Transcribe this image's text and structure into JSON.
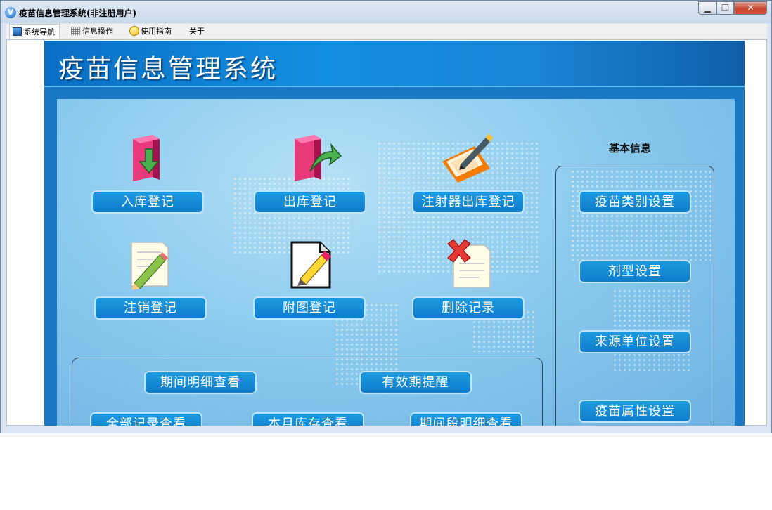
{
  "window": {
    "title": "疫苗信息管理系统(非注册用户)",
    "controls": {
      "minimize": "▁",
      "maximize": "❐",
      "close": "✕"
    }
  },
  "menu": [
    {
      "label": "系统导航",
      "icon": "nav-icon"
    },
    {
      "label": "信息操作",
      "icon": "grid-icon"
    },
    {
      "label": "使用指南",
      "icon": "help-icon"
    },
    {
      "label": "关于"
    }
  ],
  "banner": {
    "title": "疫苗信息管理系统"
  },
  "main_buttons": [
    {
      "label": "入库登记",
      "icon": "folder-in-icon"
    },
    {
      "label": "出库登记",
      "icon": "folder-out-icon"
    },
    {
      "label": "注射器出库登记",
      "icon": "pen-folder-icon"
    },
    {
      "label": "注销登记",
      "icon": "pencil-note-icon"
    },
    {
      "label": "附图登记",
      "icon": "edit-document-icon"
    },
    {
      "label": "删除记录",
      "icon": "delete-note-icon"
    }
  ],
  "query_buttons": [
    {
      "label": "期间明细查看"
    },
    {
      "label": "有效期提醒"
    },
    {
      "label": "全部记录查看"
    },
    {
      "label": "本月库存查看"
    },
    {
      "label": "期间段明细查看"
    }
  ],
  "basic_info": {
    "title": "基本信息",
    "buttons": [
      {
        "label": "疫苗类别设置"
      },
      {
        "label": "剂型设置"
      },
      {
        "label": "来源单位设置"
      },
      {
        "label": "疫苗属性设置"
      }
    ]
  },
  "colors": {
    "banner": "#138fe0",
    "button": "#1c9be0",
    "close": "#c6452d"
  }
}
